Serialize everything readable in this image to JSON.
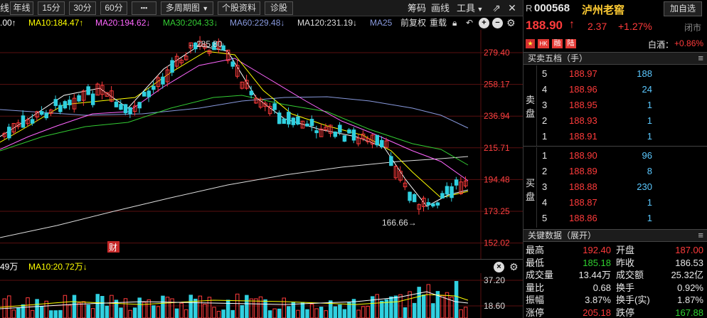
{
  "toolbar": {
    "first_partial": "线",
    "buttons": [
      "年线",
      "15分",
      "30分",
      "60分",
      "▪▪▪",
      "多周期图",
      "个股资料",
      "诊股"
    ],
    "right_links": [
      "筹码",
      "画线",
      "工具"
    ]
  },
  "ma_legend": {
    "first": ".00↑",
    "ma10": "MA10:184.47↑",
    "ma20": "MA20:194.62↓",
    "ma30": "MA30:204.33↓",
    "ma60": "MA60:229.48↓",
    "ma120": "MA120:231.19↓",
    "ma25": "MA25",
    "fq": "前复权",
    "reload": "重载"
  },
  "colors": {
    "ma5": "#ffffff",
    "ma10": "#ffff00",
    "ma20": "#ff66ff",
    "ma30": "#33cc33",
    "ma60": "#8899dd",
    "ma120": "#dddddd",
    "up": "#ff3b3b",
    "down": "#30d0e0",
    "accent_red": "#ff3b3b",
    "accent_green": "#2fd12f"
  },
  "price_axis": [
    "279.40",
    "258.17",
    "236.94",
    "215.71",
    "194.48",
    "173.25",
    "152.02"
  ],
  "annotations": {
    "high_label": "←285.80",
    "low_label": "166.66→",
    "fin_badge": "财"
  },
  "volume": {
    "header_partial": "49万",
    "ma10": "MA10:20.72万↓",
    "axis": [
      "37.20",
      "18.60"
    ]
  },
  "stock": {
    "prefix": "R",
    "code": "000568",
    "name": "泸州老窖",
    "add_btn": "加自选",
    "price": "188.90",
    "arrow": "↑",
    "change": "2.37",
    "change_pct": "+1.27%",
    "status": "闭市",
    "sector_label": "白酒：",
    "sector_pct": "+0.86%",
    "flags": [
      "HK",
      "融",
      "陆"
    ]
  },
  "order_book": {
    "title": "买卖五档（手）",
    "sell_label": [
      "卖",
      "盘"
    ],
    "buy_label": [
      "买",
      "盘"
    ],
    "sell": [
      {
        "level": "5",
        "price": "188.97",
        "vol": "188"
      },
      {
        "level": "4",
        "price": "188.96",
        "vol": "24"
      },
      {
        "level": "3",
        "price": "188.95",
        "vol": "1"
      },
      {
        "level": "2",
        "price": "188.93",
        "vol": "1"
      },
      {
        "level": "1",
        "price": "188.91",
        "vol": "1"
      }
    ],
    "buy": [
      {
        "level": "1",
        "price": "188.90",
        "vol": "96"
      },
      {
        "level": "2",
        "price": "188.89",
        "vol": "8"
      },
      {
        "level": "3",
        "price": "188.88",
        "vol": "230"
      },
      {
        "level": "4",
        "price": "188.87",
        "vol": "1"
      },
      {
        "level": "5",
        "price": "188.86",
        "vol": "1"
      }
    ]
  },
  "key_data": {
    "title": "关键数据（展开）",
    "rows": [
      {
        "l1": "最高",
        "v1": "192.40",
        "l2": "开盘",
        "v2": "187.00",
        "c1": "red",
        "c2": "red"
      },
      {
        "l1": "最低",
        "v1": "185.18",
        "l2": "昨收",
        "v2": "186.53",
        "c1": "green",
        "c2": "white"
      },
      {
        "l1": "成交量",
        "v1": "13.44万",
        "l2": "成交额",
        "v2": "25.32亿",
        "c1": "white",
        "c2": "white"
      },
      {
        "l1": "量比",
        "v1": "0.68",
        "l2": "换手",
        "v2": "0.92%",
        "c1": "white",
        "c2": "white"
      },
      {
        "l1": "振幅",
        "v1": "3.87%",
        "l2": "换手(实)",
        "v2": "1.87%",
        "c1": "white",
        "c2": "white"
      },
      {
        "l1": "涨停",
        "v1": "205.18",
        "l2": "跌停",
        "v2": "167.88",
        "c1": "red",
        "c2": "green"
      }
    ]
  }
}
